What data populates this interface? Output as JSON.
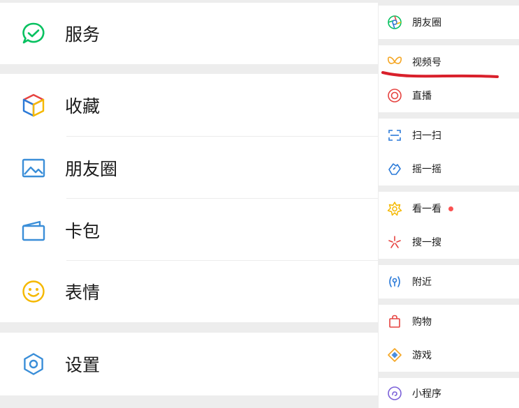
{
  "left_menu": {
    "items": [
      {
        "label": "服务",
        "icon": "service-icon"
      },
      {
        "label": "收藏",
        "icon": "favorites-cube-icon"
      },
      {
        "label": "朋友圈",
        "icon": "moments-image-icon"
      },
      {
        "label": "卡包",
        "icon": "card-wallet-icon"
      },
      {
        "label": "表情",
        "icon": "sticker-smiley-icon"
      },
      {
        "label": "设置",
        "icon": "settings-gear-icon"
      }
    ]
  },
  "right_menu": {
    "items": [
      {
        "label": "朋友圈",
        "icon": "moments-aperture-icon"
      },
      {
        "label": "视频号",
        "icon": "channels-butterfly-icon"
      },
      {
        "label": "直播",
        "icon": "live-circle-icon"
      },
      {
        "label": "扫一扫",
        "icon": "scan-icon"
      },
      {
        "label": "摇一摇",
        "icon": "shake-icon"
      },
      {
        "label": "看一看",
        "icon": "top-stories-icon",
        "badge": true
      },
      {
        "label": "搜一搜",
        "icon": "search-sparkle-icon"
      },
      {
        "label": "附近",
        "icon": "nearby-icon"
      },
      {
        "label": "购物",
        "icon": "shopping-bag-icon"
      },
      {
        "label": "游戏",
        "icon": "games-diamond-icon"
      },
      {
        "label": "小程序",
        "icon": "mini-programs-icon"
      }
    ]
  },
  "colors": {
    "green": "#07c160",
    "blue": "#3a8ed8",
    "yellow": "#f5b800",
    "red": "#fa5151",
    "annotation_red": "#d9202b",
    "background": "#ededed"
  }
}
